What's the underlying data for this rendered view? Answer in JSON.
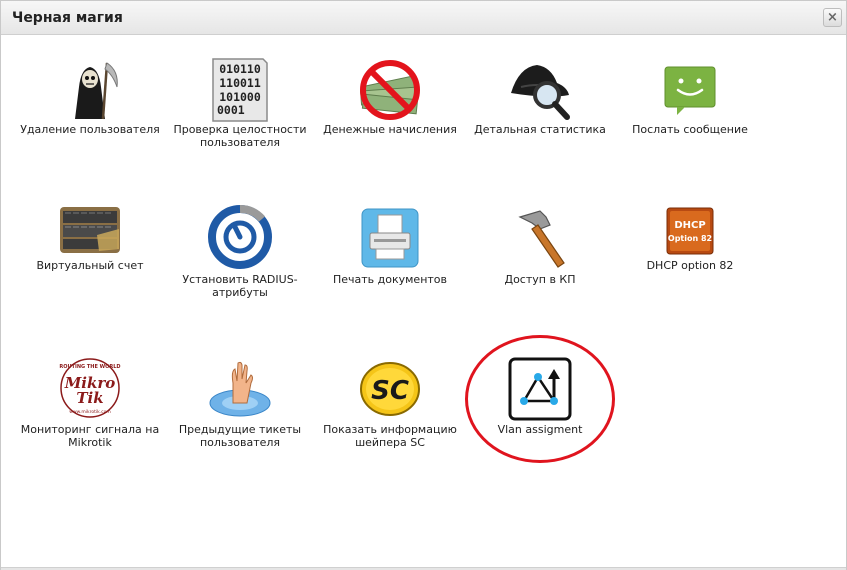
{
  "window": {
    "title": "Черная магия",
    "close_label": "×"
  },
  "tools": [
    {
      "label": "Удаление пользователя",
      "icon": "grim-reaper-icon"
    },
    {
      "label": "Проверка целостности пользователя",
      "icon": "binary-document-icon",
      "icon_text": [
        "010110",
        "110011",
        "101000",
        "0001"
      ]
    },
    {
      "label": "Денежные начисления",
      "icon": "no-money-icon"
    },
    {
      "label": "Детальная статистика",
      "icon": "detective-magnifier-icon"
    },
    {
      "label": "Послать сообщение",
      "icon": "message-bubble-icon"
    },
    {
      "label": "Виртуальный счет",
      "icon": "keyboard-cash-icon"
    },
    {
      "label": "Установить RADIUS-атрибуты",
      "icon": "radius-logo-icon"
    },
    {
      "label": "Печать документов",
      "icon": "printer-icon"
    },
    {
      "label": "Доступ в КП",
      "icon": "hammer-icon"
    },
    {
      "label": "DHCP option 82",
      "icon": "dhcp-option-icon",
      "icon_text": [
        "DHCP",
        "Option 82"
      ]
    },
    {
      "label": "Мониторинг сигнала на Mikrotik",
      "icon": "mikrotik-logo-icon",
      "icon_text": [
        "ROUTING THE WORLD",
        "Mikro",
        "Tik",
        "www.mikrotik.com"
      ]
    },
    {
      "label": "Предыдущие тикеты пользователя",
      "icon": "drowning-hand-icon"
    },
    {
      "label": "Показать информацию шейпера SC",
      "icon": "sc-logo-icon",
      "icon_text": [
        "SC"
      ]
    },
    {
      "label": "Vlan assigment",
      "icon": "vlan-graph-icon"
    }
  ],
  "colors": {
    "highlight_circle": "#e0141e",
    "message_green": "#7cb342",
    "radius_blue": "#1f5aa6"
  }
}
